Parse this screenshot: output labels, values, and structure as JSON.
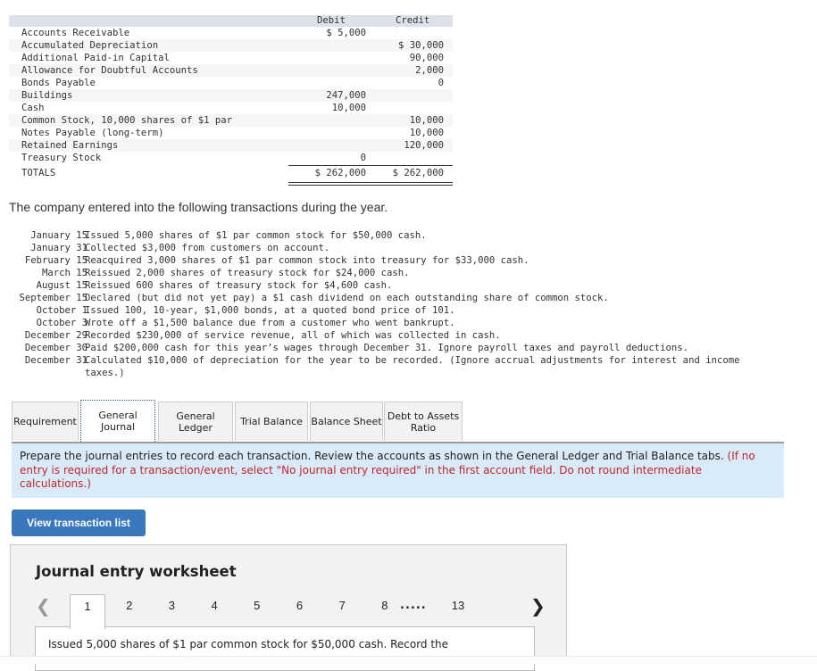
{
  "trial_balance": {
    "headers": {
      "debit": "Debit",
      "credit": "Credit"
    },
    "rows": [
      {
        "account": "Accounts Receivable",
        "debit": "$ 5,000",
        "credit": ""
      },
      {
        "account": "Accumulated Depreciation",
        "debit": "",
        "credit": "$ 30,000"
      },
      {
        "account": "Additional Paid-in Capital",
        "debit": "",
        "credit": "90,000"
      },
      {
        "account": "Allowance for Doubtful Accounts",
        "debit": "",
        "credit": "2,000"
      },
      {
        "account": "Bonds Payable",
        "debit": "",
        "credit": "0"
      },
      {
        "account": "Buildings",
        "debit": "247,000",
        "credit": ""
      },
      {
        "account": "Cash",
        "debit": "10,000",
        "credit": ""
      },
      {
        "account": "Common Stock, 10,000 shares of $1 par",
        "debit": "",
        "credit": "10,000"
      },
      {
        "account": "Notes Payable (long-term)",
        "debit": "",
        "credit": "10,000"
      },
      {
        "account": "Retained Earnings",
        "debit": "",
        "credit": "120,000"
      },
      {
        "account": "Treasury Stock",
        "debit": "0",
        "credit": ""
      }
    ],
    "totals": {
      "label": "TOTALS",
      "debit": "$ 262,000",
      "credit": "$ 262,000"
    }
  },
  "intro_text": "The company entered into the following transactions during the year.",
  "transactions": [
    {
      "date": "January 15",
      "text": "Issued 5,000 shares of $1 par common stock for $50,000 cash."
    },
    {
      "date": "January 31",
      "text": "Collected $3,000 from customers on account."
    },
    {
      "date": "February 15",
      "text": "Reacquired 3,000 shares of $1 par common stock into treasury for $33,000 cash."
    },
    {
      "date": "March 15",
      "text": "Reissued 2,000 shares of treasury stock for $24,000 cash."
    },
    {
      "date": "August 15",
      "text": "Reissued 600 shares of treasury stock for $4,600 cash."
    },
    {
      "date": "September 15",
      "text": "Declared (but did not yet pay) a $1 cash dividend on each outstanding share of common stock."
    },
    {
      "date": "October 1",
      "text": "Issued 100, 10-year, $1,000 bonds, at a quoted bond price of 101."
    },
    {
      "date": "October 3",
      "text": "Wrote off a $1,500 balance due from a customer who went bankrupt."
    },
    {
      "date": "December 29",
      "text": "Recorded $230,000 of service revenue, all of which was collected in cash."
    },
    {
      "date": "December 30",
      "text": "Paid $200,000 cash for this year’s wages through December 31. Ignore payroll taxes and payroll deductions."
    },
    {
      "date": "December 31",
      "text": "Calculated $10,000 of depreciation for the year to be recorded. (Ignore accrual adjustments for interest and income"
    },
    {
      "date": "",
      "text": "taxes.)"
    }
  ],
  "tabs": [
    {
      "line1": "Requirement",
      "line2": "",
      "active": false
    },
    {
      "line1": "General",
      "line2": "Journal",
      "active": true
    },
    {
      "line1": "General",
      "line2": "Ledger",
      "active": false
    },
    {
      "line1": "Trial Balance",
      "line2": "",
      "active": false
    },
    {
      "line1": "Balance Sheet",
      "line2": "",
      "active": false
    },
    {
      "line1": "Debt to Assets",
      "line2": "Ratio",
      "active": false
    }
  ],
  "instructions": {
    "main": "Prepare the journal entries to record each transaction. Review the accounts as shown in the General Ledger and Trial Balance tabs. ",
    "note": "(If no entry is required for a transaction/event, select \"No journal entry required\" in the first account field. Do not round intermediate calculations.)"
  },
  "view_transaction_list_label": "View transaction list",
  "worksheet": {
    "title": "Journal entry worksheet",
    "prev_icon": "chevron-left-icon",
    "next_icon": "chevron-right-icon",
    "pages": [
      "1",
      "2",
      "3",
      "4",
      "5",
      "6",
      "7",
      "8"
    ],
    "ellipsis": ".....",
    "last_page": "13",
    "active_page": "1",
    "panel_text": "Issued 5,000 shares of $1 par common stock for $50,000 cash. Record the"
  },
  "colors": {
    "accent_button": "#3a78bd",
    "instruction_bg": "#d9ebf8",
    "note_red": "#c0262d",
    "table_header_bg": "#dde1ea"
  }
}
